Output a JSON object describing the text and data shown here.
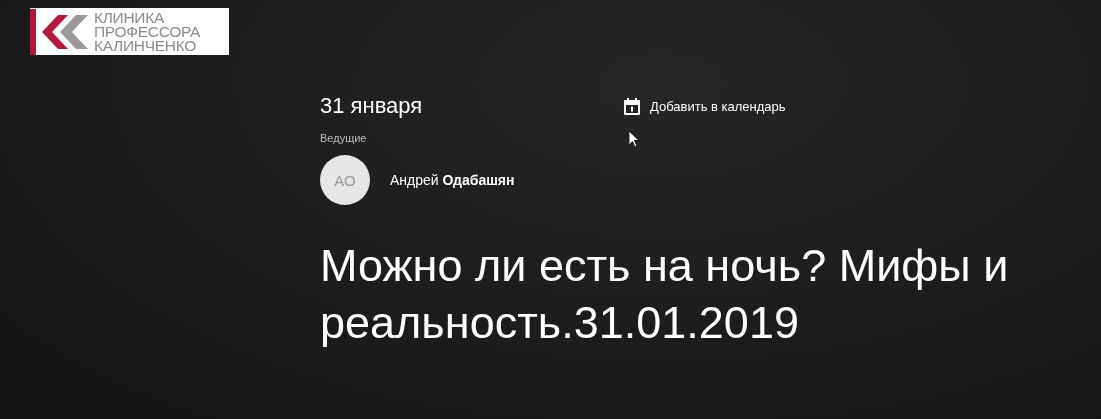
{
  "logo": {
    "lines": [
      "КЛИНИКА",
      "ПРОФЕССОРА",
      "КАЛИНЧЕНКО"
    ]
  },
  "event": {
    "date": "31 января",
    "calendar_link": "Добавить в календарь",
    "hosts_label": "Ведущие",
    "hosts": [
      {
        "initials": "АО",
        "name": "Андрей **Одабашян**"
      }
    ],
    "title": "Можно ли есть на ночь? Мифы и реальность.31.01.2019"
  }
}
